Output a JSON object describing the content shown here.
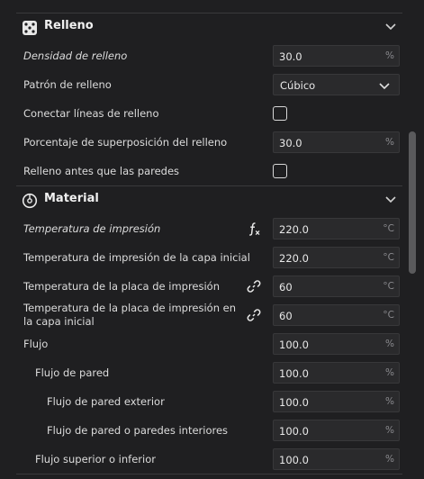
{
  "sections": {
    "relleno": {
      "title": "Relleno",
      "icon": "infill-dice-icon"
    },
    "material": {
      "title": "Material",
      "icon": "material-spool-icon"
    }
  },
  "relleno_rows": {
    "density": {
      "label": "Densidad de relleno",
      "value": "30.0",
      "unit": "%"
    },
    "pattern": {
      "label": "Patrón de relleno",
      "value": "Cúbico"
    },
    "connect": {
      "label": "Conectar líneas de relleno",
      "checked": false
    },
    "overlap": {
      "label": "Porcentaje de superposición del relleno",
      "value": "30.0",
      "unit": "%"
    },
    "before_walls": {
      "label": "Relleno antes que las paredes",
      "checked": false
    }
  },
  "material_rows": {
    "print_temp": {
      "label": "Temperatura de impresión",
      "value": "220.0",
      "unit": "°C"
    },
    "print_temp_initial": {
      "label": "Temperatura de impresión de la capa inicial",
      "value": "220.0",
      "unit": "°C"
    },
    "bed_temp": {
      "label": "Temperatura de la placa de impresión",
      "value": "60",
      "unit": "°C"
    },
    "bed_temp_initial": {
      "label": "Temperatura de la placa de impresión en la capa inicial",
      "value": "60",
      "unit": "°C"
    },
    "flow": {
      "label": "Flujo",
      "value": "100.0",
      "unit": "%"
    },
    "wall_flow": {
      "label": "Flujo de pared",
      "value": "100.0",
      "unit": "%"
    },
    "outer_wall_flow": {
      "label": "Flujo de pared exterior",
      "value": "100.0",
      "unit": "%"
    },
    "inner_wall_flow": {
      "label": "Flujo de pared o paredes interiores",
      "value": "100.0",
      "unit": "%"
    },
    "top_bottom_flow": {
      "label": "Flujo superior o inferior",
      "value": "100.0",
      "unit": "%"
    }
  },
  "colors": {
    "background": "#1f1f21",
    "field_bg": "#2a2a2c",
    "border": "#38383a",
    "text": "#dcdcdc"
  }
}
